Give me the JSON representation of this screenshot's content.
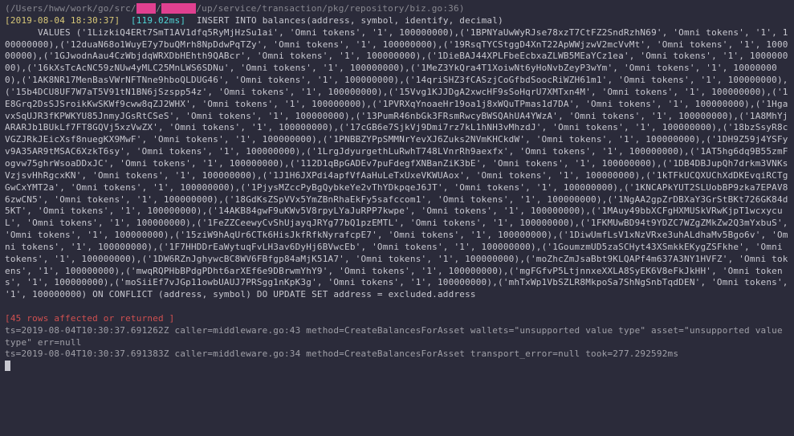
{
  "header": {
    "path_start": "(/Users/hww/work/go/src/",
    "path_mask1": "   ",
    "path_mid": "/",
    "path_mask2": "    ",
    "path_end": "/up/service/transaction/pkg/repository/biz.go:36)"
  },
  "timestamp": "[2019-08-04 18:30:37]",
  "timing": "[119.02ms]",
  "sql_insert": "INSERT INTO balances(address, symbol, identify, decimal)",
  "sql_body": "      VALUES ('1LizkiQ4ERt7SmT1AV1dfq5RyMjHzSu1ai', 'Omni tokens', '1', 100000000),('1BPNYaUwWyRJse78xzT7CtFZ2SndRzhN69', 'Omni tokens', '1', 100000000),('12duaN68o1WuyE7y7buQMrh8NpDdwPqTZy', 'Omni tokens', '1', 100000000),('19RsqTYCStggD4XnT22ApWWjzwV2mcVvMt', 'Omni tokens', '1', 100000000),('1GJwodnAau4CzWbjdqWRXDbHEhth9QABcr', 'Omni tokens', '1', 100000000),('1DieBAJ44XPLFbeEcbxaZLWB5MEaYCz1ea', 'Omni tokens', '1', 100000000),('16kXsTcAcNC59zNUw4yMLC25MnLWS6SDNu', 'Omni tokens', '1', 100000000),('1MeZ3YkQra4T1XoiwNt6yHoNvbZeyP3wYm', 'Omni tokens', '1', 100000000),('1AK8NR17MenBasVWrNFTNne9hboQLDUG46', 'Omni tokens', '1', 100000000),('14qriSHZ3fCASzjCoGfbdSoocRiWZH61m1', 'Omni tokens', '1', 100000000),('15b4DCU8UF7W7aT5V91tN1BN6jSzspp54z', 'Omni tokens', '1', 100000000),('15Vvg1KJJDgA2xwcHF9sSoHqrU7XMTxn4M', 'Omni tokens', '1', 100000000),('1E8Grq2DsSJSroikKwSKWf9cww8qZJ2WHX', 'Omni tokens', '1', 100000000),('1PVRXqYnoaeHr19oa1j8xWQuTPmas1d7DA', 'Omni tokens', '1', 100000000),('1HgavxSqUJR3fKPWKYU85JnmyJGsRtCSeS', 'Omni tokens', '1', 100000000),('13PumR46nbGk3FRsmRwcyBWSQAhUA4YWzA', 'Omni tokens', '1', 100000000),('1A8MhYjARARJb1BUkLf7FT8GQVj5xzVwZX', 'Omni tokens', '1', 100000000),('17cGB6e7SjkVj9Dmi7rz7kL1hNH3vMhzdJ', 'Omni tokens', '1', 100000000),('18bzSsyR8cVGZJRkJEicXsf8nuegKX9MwF', 'Omni tokens', '1', 100000000),('1PNBBZYPpSMMNrYevXJ6Zuks2NVmKHCkdW', 'Omni tokens', '1', 100000000),('1DH9Z59j4YSFyv9A35AR9tMSAC6XzkT6sy', 'Omni tokens', '1', 100000000),('1LrgJdyurgethLuRwhT748LVnrRh9aexfx', 'Omni tokens', '1', 100000000),('1AT5hg6dq9B55zmFogvw75ghrWsoaDDxJC', 'Omni tokens', '1', 100000000),('112D1qBpGADEv7puFdegfXNBanZiK3bE', 'Omni tokens', '1', 100000000),('1DB4DBJupQh7drkm3VNKsVzjsvHhRgcxKN', 'Omni tokens', '1', 100000000),('1J1H6JXPdi4apfVfAaHuLeTxUxeVKWUAox', 'Omni tokens', '1', 100000000),('1kTFkUCQXUChXdDKEvqiRCTgGwCxYMT2a', 'Omni tokens', '1', 100000000),('1PjysMZccPyBgQybkeYe2vThYDkpqeJ6JT', 'Omni tokens', '1', 100000000),('1KNCAPkYUT2SLUobBP9zka7EPAV86zwCN5', 'Omni tokens', '1', 100000000),('18GdKsZSpVVx5YmZBnRhaEkFy5safccom1', 'Omni tokens', '1', 100000000),('1NgAA2gpZrDBXaY3GrStBKt726GK84d5KT', 'Omni tokens', '1', 100000000),('14AKB84gwF9uKWv5V8rpyLYaJuRPP7kwpe', 'Omni tokens', '1', 100000000),('1MAuy49bbXCFgHXMUSkVRwKjpT1wcxycuL', 'Omni tokens', '1', 100000000),('1FeZZCeewyCvShUjayqJRYg77bQ1pzEMTL', 'Omni tokens', '1', 100000000),('1FKMUwBD94t9YDZC7WZgZMkZw2Q3mYxbuS', 'Omni tokens', '1', 100000000),('15ziW9hAqUr6CTk6HisJkfRfkNyrafcpE7', 'Omni tokens', '1', 100000000),('1DiwUmfLsV1xNzVRxe3uhALdhaMv5Bgo6v', 'Omni tokens', '1', 100000000),('1F7HHDDrEaWytuqFvLH3av6DyHj6BVwcEb', 'Omni tokens', '1', 100000000),('1GoumzmUD5zaSCHyt43XSmkkEKygZSFkhe', 'Omni tokens', '1', 100000000),('1DW6RZnJghywcBC8WV6FBfgp84aMjK51A7', 'Omni tokens', '1', 100000000),('moZhcZmJsaBbt9KLQAPf4m637A3NY1HVFZ', 'Omni tokens', '1', 100000000),('mwqRQPHbBPdgPDht6arXEf6e9DBrwmYhY9', 'Omni tokens', '1', 100000000),('mgFGfvP5LtjnnxeXXLA8SyEK6V8eFkJkHH', 'Omni tokens', '1', 100000000),('moSiiEf7vJGp11owbUAUJ7PRSgg1nKpK3g', 'Omni tokens', '1', 100000000),('mhTxWp1VbSZLR8MkpoSa7ShNgSnbTqdDEN', 'Omni tokens', '1', 100000000) ON CONFLICT (address, symbol) DO UPDATE SET address = excluded.address",
  "affected": "[45 rows affected or returned ]",
  "log1": "ts=2019-08-04T10:30:37.691262Z caller=middleware.go:43 method=CreateBalancesForAsset wallets=\"unsupported value type\" asset=\"unsupported value type\" err=null",
  "log2": "ts=2019-08-04T10:30:37.691383Z caller=middleware.go:34 method=CreateBalancesForAsset transport_error=null took=277.292592ms"
}
